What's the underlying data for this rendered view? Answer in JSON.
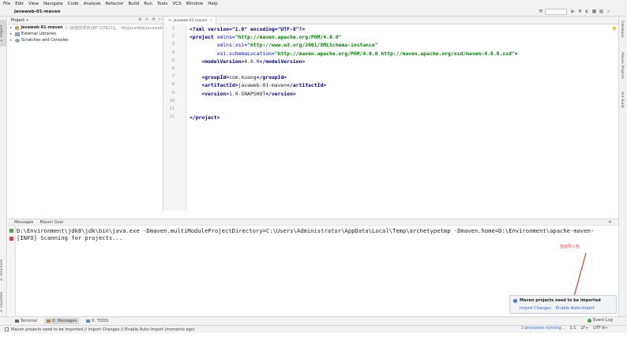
{
  "menu": [
    "File",
    "Edit",
    "View",
    "Navigate",
    "Code",
    "Analyze",
    "Refactor",
    "Build",
    "Run",
    "Tools",
    "VCS",
    "Window",
    "Help"
  ],
  "nav": {
    "breadcrumb": "javaweb-01-maven"
  },
  "left_strip": {
    "project_tab": "1: Project",
    "structure_tab": "Z: Structure",
    "favorites_tab": "2: Favorites"
  },
  "right_strip": {
    "database_tab": "Database",
    "maven_tab": "Maven Projects",
    "ant_tab": "Ant Build"
  },
  "project_panel": {
    "header_label": "Project",
    "tree": [
      {
        "name": "javaweb-01-maven",
        "path": "C:\\新建的项目\\JBP 2\\0621\\J... \\lib\\JavaWeb\\javaweb",
        "icon": "folder-icon",
        "bold": true
      },
      {
        "name": "External Libraries",
        "path": "",
        "icon": "library-icon",
        "bold": false
      },
      {
        "name": "Scratches and Consoles",
        "path": "",
        "icon": "scratch-icon",
        "bold": false
      }
    ]
  },
  "editor": {
    "tab_label": "javaweb-01-maven",
    "line_numbers": [
      "1",
      "2",
      "3",
      "4",
      "5",
      "6",
      "7",
      "8",
      "9",
      "10",
      "11",
      "12"
    ],
    "lines": [
      [
        {
          "t": "pi",
          "v": "<?xml version=\"1.0\" encoding=\"UTF-8\"?>"
        }
      ],
      [
        {
          "t": "tag",
          "v": "<project "
        },
        {
          "t": "attr",
          "v": "xmlns="
        },
        {
          "t": "val",
          "v": "\"http://maven.apache.org/POM/4.0.0\""
        }
      ],
      [
        {
          "t": "text",
          "v": "         "
        },
        {
          "t": "attr",
          "v": "xmlns:xsi="
        },
        {
          "t": "val",
          "v": "\"http://www.w3.org/2001/XMLSchema-instance\""
        }
      ],
      [
        {
          "t": "text",
          "v": "         "
        },
        {
          "t": "attr",
          "v": "xsi:schemaLocation="
        },
        {
          "t": "val",
          "v": "\"http://maven.apache.org/POM/4.0.0 http://maven.apache.org/xsd/maven-4.0.0.xsd\""
        },
        {
          "t": "tag",
          "v": ">"
        }
      ],
      [
        {
          "t": "text",
          "v": "    "
        },
        {
          "t": "tag",
          "v": "<modelVersion>"
        },
        {
          "t": "text",
          "v": "4.0.0"
        },
        {
          "t": "tag",
          "v": "</modelVersion>"
        }
      ],
      [],
      [
        {
          "t": "text",
          "v": "    "
        },
        {
          "t": "tag",
          "v": "<groupId>"
        },
        {
          "t": "text",
          "v": "com.kuang"
        },
        {
          "t": "tag",
          "v": "</groupId>"
        }
      ],
      [
        {
          "t": "text",
          "v": "    "
        },
        {
          "t": "tag",
          "v": "<artifactId>"
        },
        {
          "t": "text",
          "v": "javaweb-01-maven"
        },
        {
          "t": "tag",
          "v": "</artifactId>"
        }
      ],
      [
        {
          "t": "text",
          "v": "    "
        },
        {
          "t": "tag",
          "v": "<version>"
        },
        {
          "t": "text",
          "v": "1.0-SNAPSHOT"
        },
        {
          "t": "tag",
          "v": "</version>"
        }
      ],
      [],
      [],
      [
        {
          "t": "tag",
          "v": "</project>"
        }
      ]
    ]
  },
  "messages": {
    "tabs": [
      "Messages",
      "Maven Goal"
    ],
    "lines": [
      "D:\\Environment\\jdk8\\jdk\\bin\\java.exe -Dmaven.multiModuleProjectDirectory=C:\\Users\\Administrator\\AppData\\Local\\Temp\\archetypetmp -Dmaven.home=D:\\Environment\\apache-maven-",
      "[INFO] Scanning for projects..."
    ]
  },
  "annotation": {
    "text": "自动导入包",
    "color": "#e23b2e"
  },
  "balloon": {
    "title": "Maven projects need to be imported",
    "import_changes": "Import Changes",
    "enable_auto_import": "Enable Auto-Import"
  },
  "bottom_tabs": [
    {
      "label": "Terminal",
      "active": false
    },
    {
      "label": "0: Messages",
      "active": true
    },
    {
      "label": "6: TODO",
      "active": false
    }
  ],
  "event_log": "Event Log",
  "status": {
    "message": "Maven projects need to be imported // Import Changes // Enable Auto-Import (moments ago)",
    "processes": "2 processes running...",
    "position": "1:1",
    "line_sep": "LF÷",
    "encoding": "UTF-8÷"
  },
  "colors": {
    "xml_tag": "#000080",
    "xml_attr": "#0000ff",
    "xml_value": "#008000",
    "link": "#2f65ca",
    "info": "#3d7cd3"
  }
}
